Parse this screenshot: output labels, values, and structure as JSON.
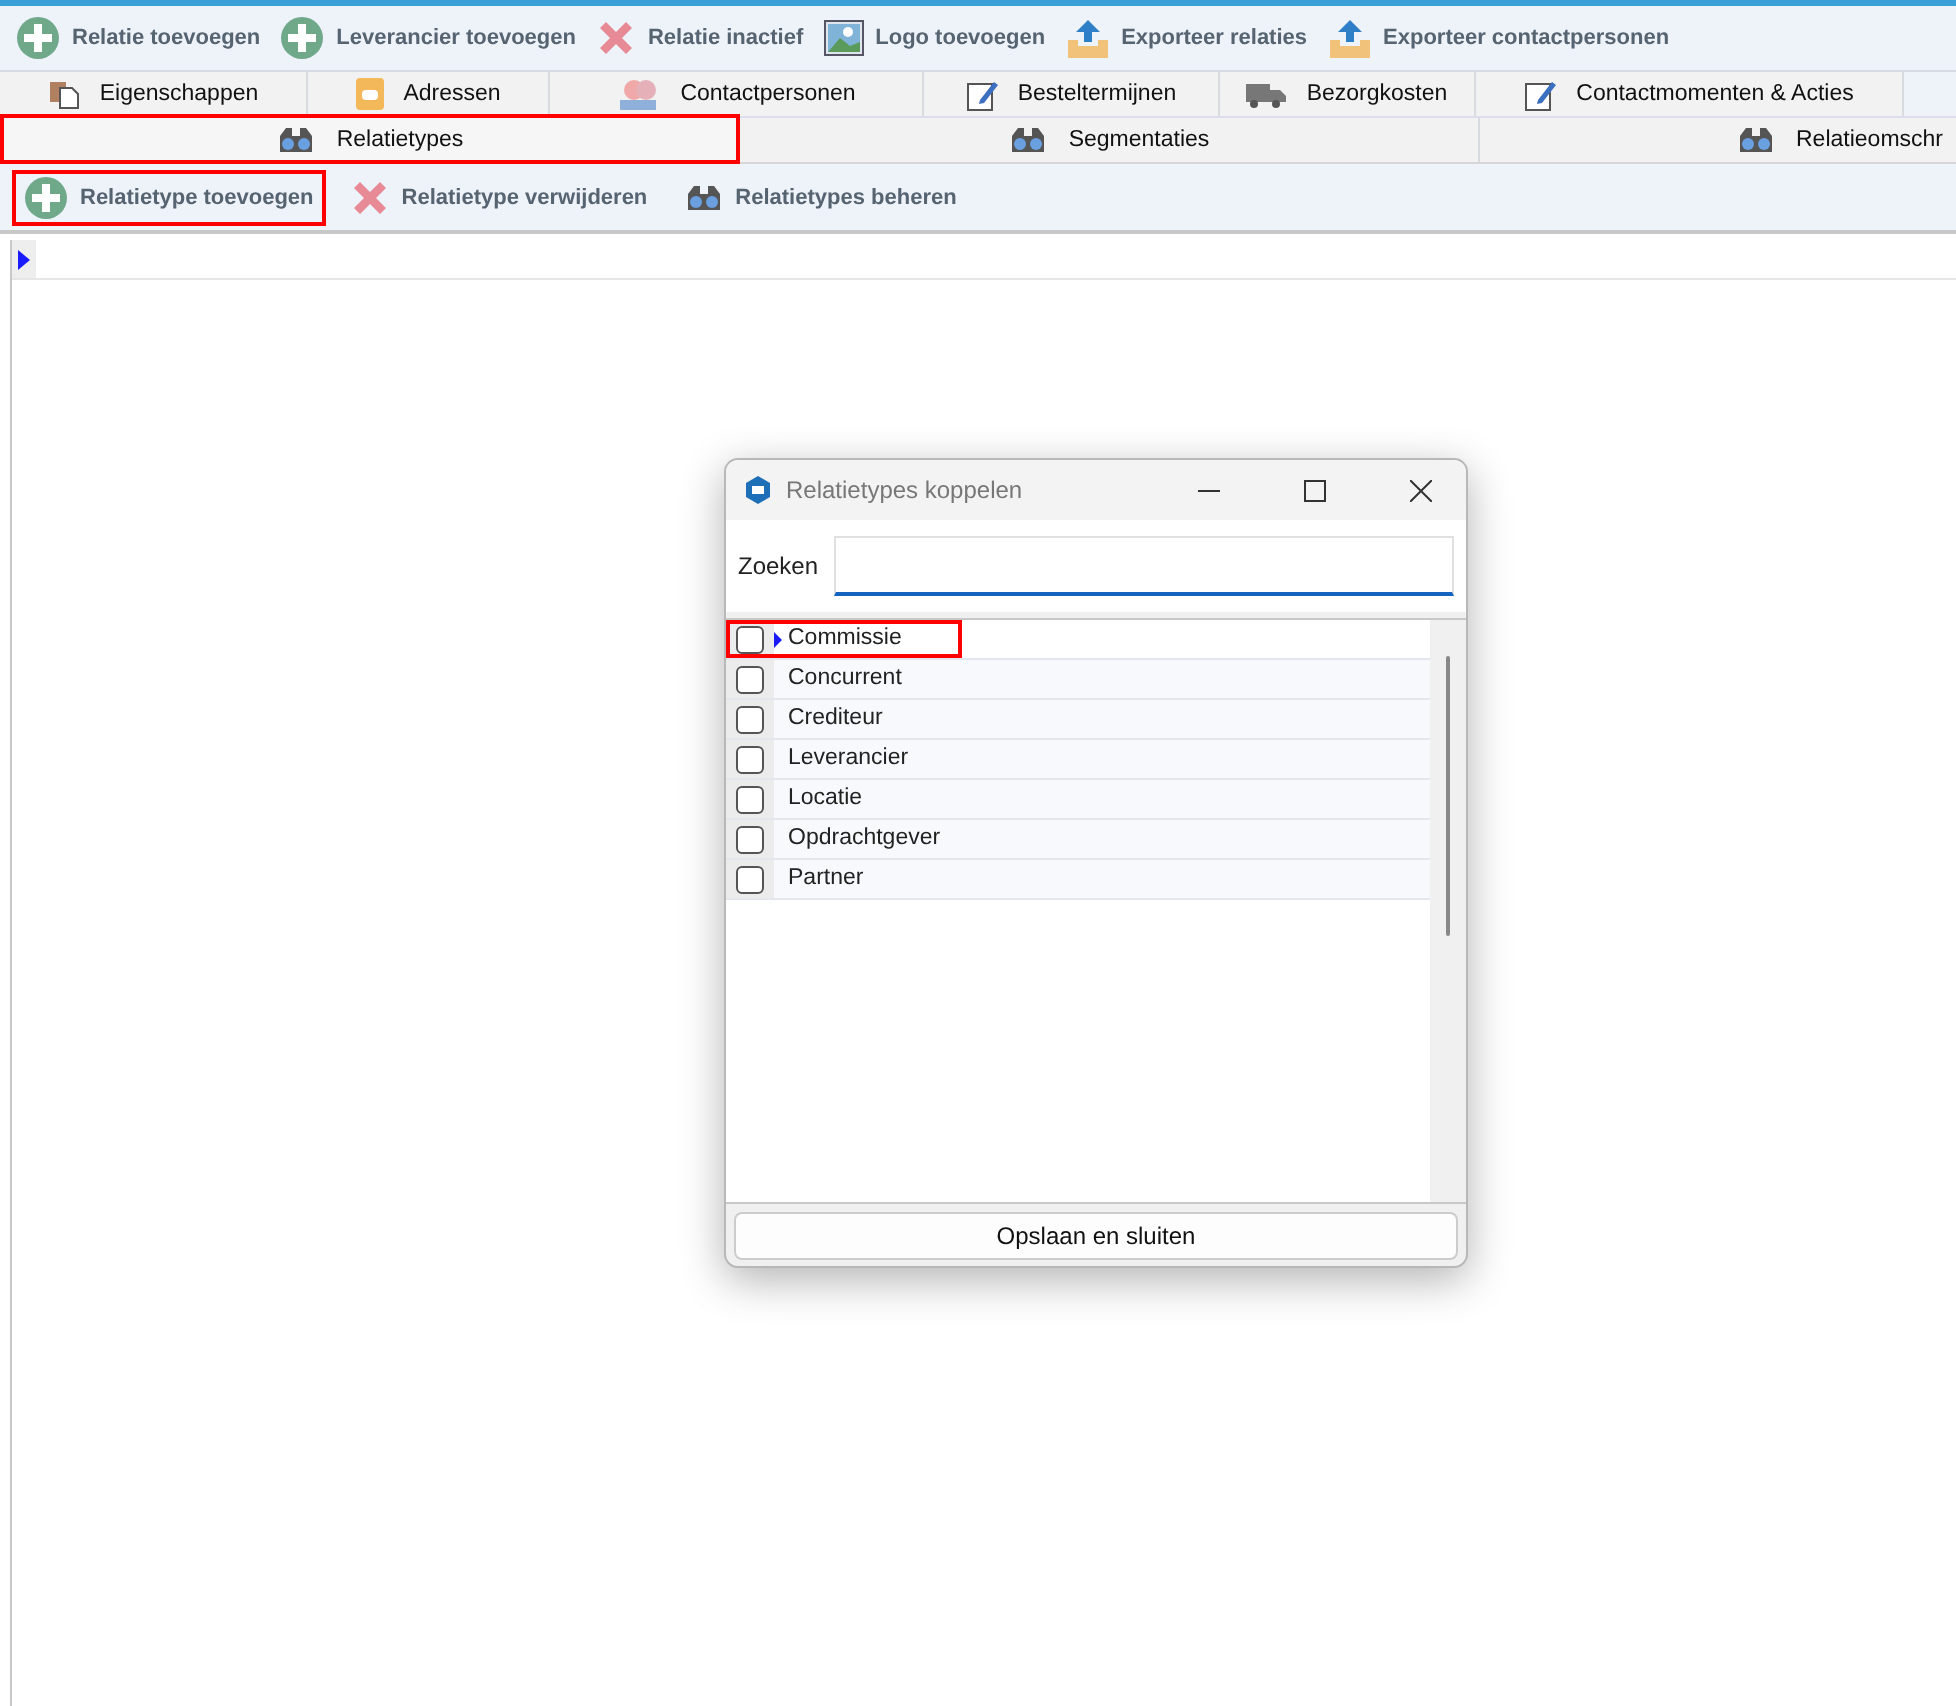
{
  "toolbar": [
    {
      "label": "Relatie toevoegen",
      "kind": "add"
    },
    {
      "label": "Leverancier toevoegen",
      "kind": "add"
    },
    {
      "label": "Relatie inactief",
      "kind": "remove"
    },
    {
      "label": "Logo toevoegen",
      "kind": "image"
    },
    {
      "label": "Exporteer relaties",
      "kind": "export"
    },
    {
      "label": "Exporteer contactpersonen",
      "kind": "export"
    }
  ],
  "tabs_row1": [
    {
      "label": "Eigenschappen",
      "kind": "pages",
      "selected": false
    },
    {
      "label": "Adressen",
      "kind": "phonebook",
      "selected": false
    },
    {
      "label": "Contactpersonen",
      "kind": "people",
      "selected": false
    },
    {
      "label": "Besteltermijnen",
      "kind": "notepad",
      "selected": false
    },
    {
      "label": "Bezorgkosten",
      "kind": "truck",
      "selected": false
    },
    {
      "label": "Contactmomenten & Acties",
      "kind": "notepad",
      "selected": false
    }
  ],
  "tabs_row2": [
    {
      "label": "Relatietypes",
      "kind": "binoculars",
      "selected": true,
      "highlighted": true
    },
    {
      "label": "Segmentaties",
      "kind": "binoculars",
      "selected": false,
      "highlighted": false
    },
    {
      "label": "Relatieomschr",
      "kind": "binoculars",
      "selected": false,
      "highlighted": false
    }
  ],
  "sub_toolbar": [
    {
      "label": "Relatietype toevoegen",
      "kind": "add",
      "highlighted": true
    },
    {
      "label": "Relatietype verwijderen",
      "kind": "remove",
      "highlighted": false
    },
    {
      "label": "Relatietypes beheren",
      "kind": "binoculars",
      "highlighted": false
    }
  ],
  "dialog": {
    "title": "Relatietypes koppelen",
    "search": {
      "label": "Zoeken"
    },
    "items": [
      {
        "label": "Commissie",
        "checked": false,
        "selected": true,
        "highlighted": true
      },
      {
        "label": "Concurrent",
        "checked": false,
        "selected": false,
        "highlighted": false
      },
      {
        "label": "Crediteur",
        "checked": false,
        "selected": false,
        "highlighted": false
      },
      {
        "label": "Leverancier",
        "checked": false,
        "selected": false,
        "highlighted": false
      },
      {
        "label": "Locatie",
        "checked": false,
        "selected": false,
        "highlighted": false
      },
      {
        "label": "Opdrachtgever",
        "checked": false,
        "selected": false,
        "highlighted": false
      },
      {
        "label": "Partner",
        "checked": false,
        "selected": false,
        "highlighted": false
      }
    ],
    "button": "Opslaan en sluiten"
  }
}
